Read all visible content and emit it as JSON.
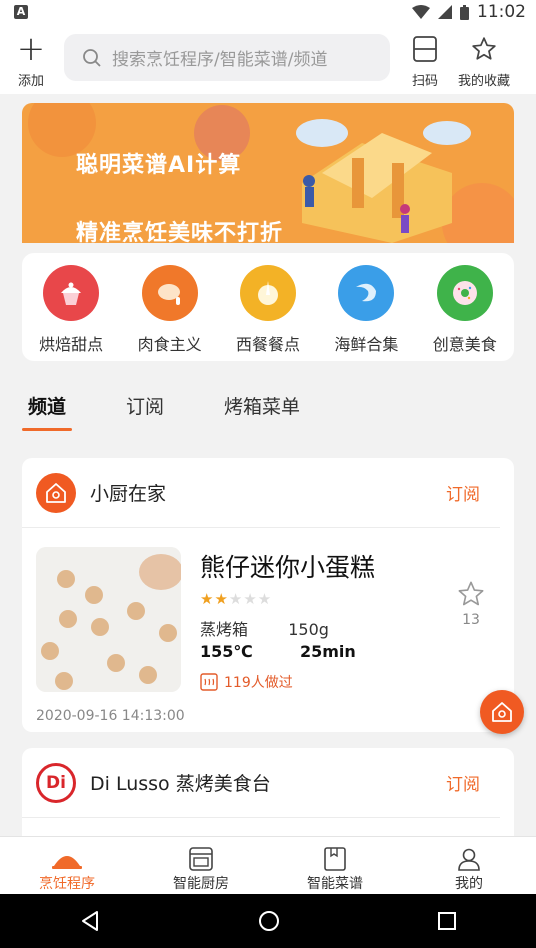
{
  "status_bar": {
    "time": "11:02",
    "left_icon": "A"
  },
  "header": {
    "add_label": "添加",
    "search_placeholder": "搜索烹饪程序/智能菜谱/频道",
    "scan_label": "扫码",
    "favorites_label": "我的收藏"
  },
  "banner": {
    "line1": "聪明菜谱AI计算",
    "line2": "精准烹饪美味不打折"
  },
  "categories": [
    {
      "label": "烘焙甜点",
      "color": "#e8474a",
      "icon": "cupcake-icon"
    },
    {
      "label": "肉食主义",
      "color": "#f0782a",
      "icon": "chicken-leg-icon"
    },
    {
      "label": "西餐餐点",
      "color": "#f3b226",
      "icon": "western-food-icon"
    },
    {
      "label": "海鲜合集",
      "color": "#3a9ee8",
      "icon": "shrimp-icon"
    },
    {
      "label": "创意美食",
      "color": "#3fb34a",
      "icon": "donut-icon"
    }
  ],
  "tabs": [
    {
      "label": "频道",
      "active": true
    },
    {
      "label": "订阅",
      "active": false
    },
    {
      "label": "烤箱菜单",
      "active": false
    }
  ],
  "channels": [
    {
      "name": "小厨在家",
      "subscribe_label": "订阅",
      "logo_color": "#f05a22",
      "recipe": {
        "title": "熊仔迷你小蛋糕",
        "rating": 2,
        "rating_max": 5,
        "device": "蒸烤箱",
        "weight": "150g",
        "temperature": "155℃",
        "duration": "25min",
        "made_count": "119人做过",
        "fav_count": "13",
        "date": "2020-09-16 14:13:00"
      }
    },
    {
      "name": "Di Lusso 蒸烤美食台",
      "subscribe_label": "订阅",
      "logo_color": "#d9262b",
      "logo_text": "Di"
    }
  ],
  "bottom_nav": [
    {
      "label": "烹饪程序",
      "icon": "cloche-icon",
      "active": true
    },
    {
      "label": "智能厨房",
      "icon": "oven-icon",
      "active": false
    },
    {
      "label": "智能菜谱",
      "icon": "recipe-book-icon",
      "active": false
    },
    {
      "label": "我的",
      "icon": "user-icon",
      "active": false
    }
  ],
  "colors": {
    "accent": "#f06a2a",
    "banner": "#f4a042"
  }
}
